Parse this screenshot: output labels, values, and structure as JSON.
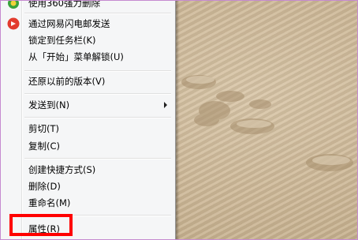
{
  "menu": {
    "items": [
      {
        "label": "使用360强力删除"
      },
      {
        "label": "通过网易闪电邮发送",
        "icon": "netease-mail-icon"
      },
      {
        "label": "锁定到任务栏(K)"
      },
      {
        "label": "从「开始」菜单解锁(U)"
      },
      {
        "label": "还原以前的版本(V)"
      },
      {
        "label": "发送到(N)",
        "submenu": true
      },
      {
        "label": "剪切(T)"
      },
      {
        "label": "复制(C)"
      },
      {
        "label": "创建快捷方式(S)"
      },
      {
        "label": "删除(D)"
      },
      {
        "label": "重命名(M)"
      },
      {
        "label": "属性(R)"
      }
    ]
  },
  "colors": {
    "annotation_box": "#ff0000",
    "menu_background": "#f5f6f7",
    "icon_red": "#e23b2e",
    "icon_green": "#3aa23a"
  }
}
